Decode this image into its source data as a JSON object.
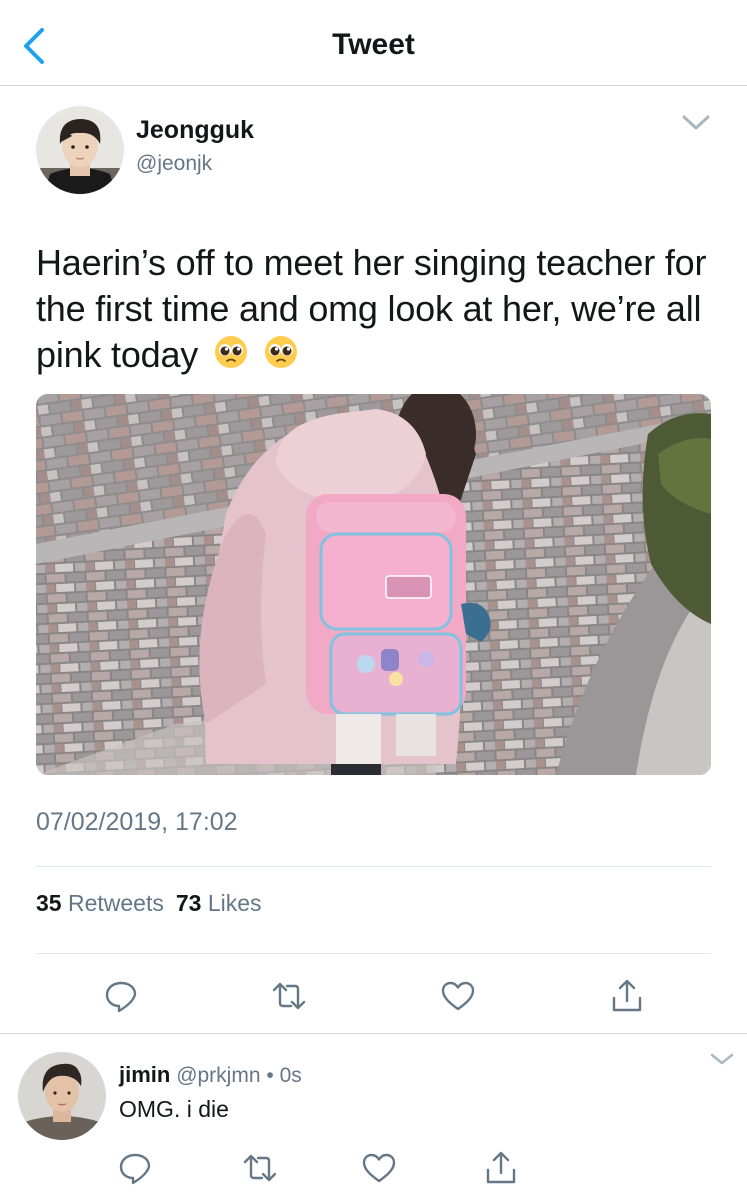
{
  "navbar": {
    "title": "Tweet",
    "back_icon": "chevron-left-icon",
    "accent_color": "#1da1f2"
  },
  "tweet": {
    "author_name": "Jeongguk",
    "author_handle": "@jeonjk",
    "text": "Haerin’s off to meet her singing teacher for the first time and omg look at her, we’re all pink today",
    "emojis": [
      "pleading-face-emoji",
      "pleading-face-emoji"
    ],
    "media_description_icon": "photo-image",
    "timestamp": "07/02/2019, 17:02",
    "retweets_count": "35",
    "retweets_label": "Retweets",
    "likes_count": "73",
    "likes_label": "Likes",
    "actions": [
      "reply-icon",
      "retweet-icon",
      "like-icon",
      "share-icon"
    ]
  },
  "reply": {
    "name": "jimin",
    "handle": "@prkjmn",
    "separator": "•",
    "time": "0s",
    "text": "OMG. i die",
    "actions": [
      "reply-icon",
      "retweet-icon",
      "like-icon",
      "share-icon"
    ]
  },
  "colors": {
    "text_primary": "#14171a",
    "text_secondary": "#657786",
    "divider": "#e1e8ed",
    "accent": "#1da1f2"
  }
}
